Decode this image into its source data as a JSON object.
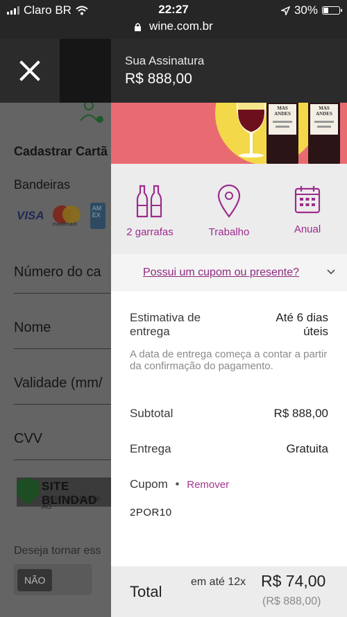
{
  "status_bar": {
    "carrier": "Claro BR",
    "time": "22:27",
    "battery": "30%"
  },
  "browser": {
    "url": "wine.com.br"
  },
  "background_form": {
    "title": "Cadastrar Cartã",
    "brands_label": "Bandeiras",
    "card_visa": "VISA",
    "card_mastercard": "mastercard",
    "card_amex": "AM EX",
    "card_number_placeholder": "Número do ca",
    "name_placeholder": "Nome",
    "validity_placeholder": "Validade (mm/",
    "cvv_placeholder": "CVV",
    "seal_text": "SITE BLINDAD",
    "seal_subtext": "AUDITADO EM 14-AG",
    "question": "Deseja tornar ess",
    "toggle_no": "NÃO"
  },
  "panel": {
    "header_title": "Sua Assinatura",
    "header_price": "R$ 888,00",
    "bottle_label": "MAS ANDES",
    "options": [
      {
        "label": "2 garrafas",
        "icon": "bottles-icon"
      },
      {
        "label": "Trabalho",
        "icon": "location-pin-icon"
      },
      {
        "label": "Anual",
        "icon": "calendar-icon"
      }
    ],
    "coupon_link": "Possui um cupom ou presente?",
    "delivery_estimate_label_1": "Estimativa de",
    "delivery_estimate_label_2": "entrega",
    "delivery_estimate_value_1": "Até 6 dias",
    "delivery_estimate_value_2": "úteis",
    "delivery_note": "A data de entrega começa a contar a partir da confirmação do pagamento.",
    "subtotal_label": "Subtotal",
    "subtotal_value": "R$ 888,00",
    "shipping_label": "Entrega",
    "shipping_value": "Gratuita",
    "coupon_label": "Cupom",
    "coupon_separator": "•",
    "remove_label": "Remover",
    "coupon_code": "2POR10",
    "total_label": "Total",
    "installment_text": "em até 12x",
    "installment_value": "R$ 74,00",
    "total_value": "(R$ 888,00)"
  },
  "colors": {
    "accent": "#9c2b8c",
    "banner": "#e96b72",
    "sun": "#f3d94a"
  }
}
